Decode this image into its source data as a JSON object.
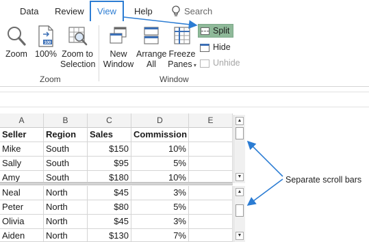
{
  "tabs": [
    "Data",
    "Review",
    "View",
    "Help"
  ],
  "search_placeholder": "Search",
  "zoom_group": {
    "label": "Zoom",
    "zoom": "Zoom",
    "zoom100": "100%",
    "zoom_to_selection_line1": "Zoom to",
    "zoom_to_selection_line2": "Selection"
  },
  "window_group": {
    "label": "Window",
    "new_window_line1": "New",
    "new_window_line2": "Window",
    "arrange_all_line1": "Arrange",
    "arrange_all_line2": "All",
    "freeze_panes_line1": "Freeze",
    "freeze_panes_line2": "Panes",
    "split": "Split",
    "hide": "Hide",
    "unhide": "Unhide"
  },
  "sheet": {
    "columns": [
      "A",
      "B",
      "C",
      "D",
      "E"
    ],
    "header": [
      "Seller",
      "Region",
      "Sales",
      "Commission"
    ],
    "top_rows": [
      [
        "Mike",
        "South",
        "$150",
        "10%"
      ],
      [
        "Sally",
        "South",
        "$95",
        "5%"
      ],
      [
        "Amy",
        "South",
        "$180",
        "10%"
      ]
    ],
    "bottom_rows": [
      [
        "Neal",
        "North",
        "$45",
        "3%"
      ],
      [
        "Peter",
        "North",
        "$80",
        "5%"
      ],
      [
        "Olivia",
        "North",
        "$45",
        "3%"
      ],
      [
        "Aiden",
        "North",
        "$130",
        "7%"
      ]
    ]
  },
  "annotation": "Separate scroll bars",
  "colors": {
    "accent": "#2b7cd3",
    "split_highlight": "#8fb999"
  }
}
